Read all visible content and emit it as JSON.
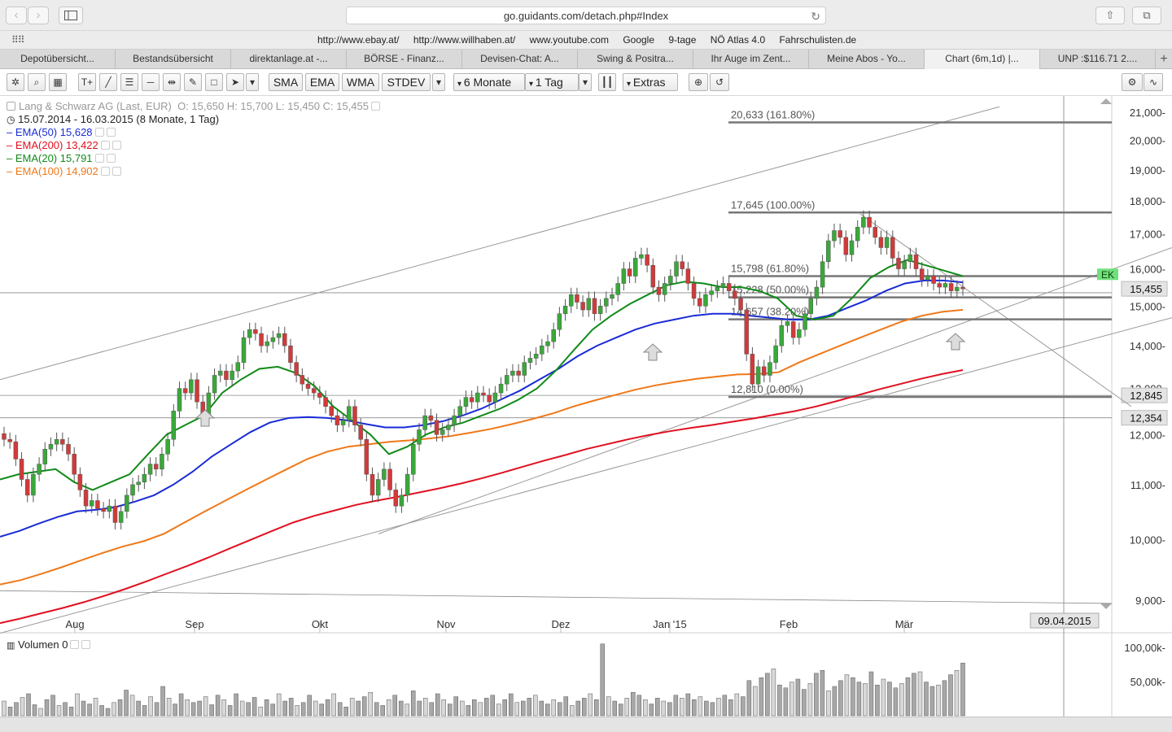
{
  "browser": {
    "url": "go.guidants.com/detach.php#Index",
    "favorites": [
      "http://www.ebay.at/",
      "http://www.willhaben.at/",
      "www.youtube.com",
      "Google",
      "9-tage",
      "NÖ Atlas 4.0",
      "Fahrschulisten.de"
    ],
    "tabs": [
      {
        "label": "Depotübersicht..."
      },
      {
        "label": "Bestandsübersicht"
      },
      {
        "label": "direktanlage.at -..."
      },
      {
        "label": "BÖRSE - Finanz..."
      },
      {
        "label": "Devisen-Chat: A..."
      },
      {
        "label": "Swing & Positra..."
      },
      {
        "label": "Ihr Auge im Zent..."
      },
      {
        "label": "Meine Abos - Yo..."
      },
      {
        "label": "Chart (6m,1d) |...",
        "active": true
      },
      {
        "label": "UNP :$116.71 2...."
      }
    ]
  },
  "toolbar": {
    "indicators": [
      "SMA",
      "EMA",
      "WMA",
      "STDEV"
    ],
    "period": "6 Monate",
    "interval": "1 Tag",
    "extras": "Extras"
  },
  "legend": {
    "instrument": "Lang & Schwarz AG (Last, EUR)",
    "ohlc": "O: 15,650  H: 15,700  L: 15,450  C: 15,455",
    "range": "15.07.2014 - 16.03.2015 (8 Monate, 1 Tag)",
    "emas": [
      {
        "name": "EMA(50)",
        "value": "15,628",
        "color": "#1a2bd6"
      },
      {
        "name": "EMA(200)",
        "value": "13,422",
        "color": "#e01020"
      },
      {
        "name": "EMA(20)",
        "value": "15,791",
        "color": "#108a18"
      },
      {
        "name": "EMA(100)",
        "value": "14,902",
        "color": "#f07818"
      }
    ]
  },
  "volume_label": "Volumen 0",
  "chart_data": {
    "type": "candlestick",
    "x_labels": [
      "Aug",
      "Sep",
      "Okt",
      "Nov",
      "Dez",
      "Jan '15",
      "Feb",
      "Mär"
    ],
    "y_ticks": [
      "21,000-",
      "20,000-",
      "19,000-",
      "18,000-",
      "17,000-",
      "16,000-",
      "15,000-",
      "14,000-",
      "13,000-",
      "12,000-",
      "11,000-",
      "10,000-",
      "9,000-"
    ],
    "y_log_scale": true,
    "volume_ticks": [
      "100,00k-",
      "50,00k-"
    ],
    "current_price_label": "15,455",
    "ek_label": "EK",
    "crosshair_date": "09.04.2015",
    "horizontal_level_labels": [
      {
        "value": 12.845,
        "label": "12,845"
      },
      {
        "value": 12.354,
        "label": "12,354"
      }
    ],
    "fibonacci": [
      {
        "value": 20.633,
        "label": "20,633 (161.80%)"
      },
      {
        "value": 17.645,
        "label": "17,645 (100.00%)"
      },
      {
        "value": 15.798,
        "label": "15,798 (61.80%)"
      },
      {
        "value": 15.228,
        "label": "15,228 (50.00%)"
      },
      {
        "value": 14.657,
        "label": "14,657 (38.20%)"
      },
      {
        "value": 12.81,
        "label": "12,810 (0.00%)"
      }
    ],
    "candles_close": [
      11.9,
      11.85,
      11.5,
      11.1,
      10.8,
      11.2,
      11.4,
      11.7,
      11.8,
      11.9,
      11.8,
      11.6,
      11.2,
      10.9,
      10.6,
      10.7,
      10.55,
      10.5,
      10.6,
      10.3,
      10.5,
      10.8,
      11.0,
      11.05,
      11.2,
      11.4,
      11.3,
      11.6,
      11.9,
      12.5,
      13.0,
      12.9,
      13.2,
      12.7,
      12.4,
      12.9,
      13.3,
      13.4,
      13.2,
      13.4,
      13.6,
      14.2,
      14.4,
      14.3,
      14.0,
      14.1,
      14.2,
      14.3,
      14.0,
      13.6,
      13.3,
      13.1,
      13.0,
      12.9,
      12.8,
      12.6,
      12.4,
      12.2,
      12.3,
      12.6,
      12.2,
      11.9,
      11.2,
      10.8,
      11.1,
      11.3,
      10.9,
      10.6,
      10.8,
      11.2,
      11.8,
      12.1,
      12.4,
      12.3,
      12.0,
      12.1,
      12.2,
      12.4,
      12.6,
      12.8,
      12.7,
      12.9,
      12.85,
      12.7,
      12.9,
      13.1,
      13.3,
      13.4,
      13.3,
      13.6,
      13.7,
      13.8,
      14.0,
      14.1,
      14.4,
      14.8,
      15.0,
      15.3,
      15.1,
      14.9,
      15.2,
      14.8,
      15.0,
      15.2,
      15.3,
      15.6,
      16.0,
      15.8,
      16.3,
      16.4,
      16.1,
      15.5,
      15.3,
      15.6,
      15.8,
      16.2,
      16.0,
      15.6,
      15.2,
      15.0,
      15.3,
      15.4,
      15.5,
      15.6,
      15.4,
      15.2,
      14.9,
      13.8,
      13.1,
      13.5,
      13.3,
      13.6,
      14.0,
      14.5,
      14.6,
      14.2,
      14.4,
      14.8,
      15.2,
      15.5,
      16.2,
      16.8,
      17.1,
      16.9,
      16.4,
      16.8,
      17.2,
      17.5,
      17.2,
      16.9,
      16.6,
      16.9,
      16.3,
      16.0,
      16.2,
      16.4,
      16.0,
      15.7,
      15.8,
      15.6,
      15.5,
      15.6,
      15.4,
      15.5,
      15.455
    ],
    "ema20": [
      11.1,
      11.2,
      11.25,
      11.3,
      11.05,
      10.9,
      11.05,
      11.2,
      11.6,
      12.0,
      12.2,
      12.4,
      12.9,
      13.2,
      13.45,
      13.5,
      13.35,
      13.05,
      12.6,
      12.3,
      12.0,
      11.6,
      11.75,
      12.0,
      12.15,
      12.25,
      12.4,
      12.55,
      12.75,
      13.0,
      13.4,
      13.9,
      14.4,
      14.75,
      15.05,
      15.3,
      15.55,
      15.65,
      15.6,
      15.5,
      15.5,
      15.4,
      15.2,
      14.75,
      14.65,
      14.75,
      15.2,
      15.75,
      16.05,
      16.25,
      16.1,
      15.95,
      15.8
    ],
    "ema50": [
      10.05,
      10.15,
      10.28,
      10.4,
      10.5,
      10.53,
      10.58,
      10.68,
      10.8,
      11.0,
      11.25,
      11.55,
      11.8,
      12.05,
      12.25,
      12.35,
      12.37,
      12.35,
      12.3,
      12.22,
      12.15,
      12.15,
      12.2,
      12.28,
      12.4,
      12.55,
      12.75,
      12.95,
      13.2,
      13.45,
      13.75,
      14.0,
      14.2,
      14.4,
      14.55,
      14.65,
      14.75,
      14.8,
      14.8,
      14.75,
      14.7,
      14.65,
      14.65,
      14.75,
      14.95,
      15.15,
      15.4,
      15.6,
      15.68,
      15.68,
      15.63
    ],
    "ema100": [
      9.25,
      9.32,
      9.42,
      9.53,
      9.65,
      9.77,
      9.88,
      9.97,
      10.1,
      10.3,
      10.5,
      10.7,
      10.9,
      11.1,
      11.3,
      11.5,
      11.65,
      11.75,
      11.8,
      11.85,
      11.88,
      11.92,
      11.97,
      12.04,
      12.12,
      12.22,
      12.33,
      12.45,
      12.6,
      12.73,
      12.85,
      12.97,
      13.07,
      13.15,
      13.22,
      13.27,
      13.32,
      13.33,
      13.37,
      13.6,
      13.8,
      14.0,
      14.2,
      14.4,
      14.6,
      14.75,
      14.85,
      14.902
    ],
    "ema200": [
      8.65,
      8.72,
      8.8,
      8.88,
      8.97,
      9.07,
      9.18,
      9.3,
      9.43,
      9.56,
      9.7,
      9.85,
      10.0,
      10.15,
      10.3,
      10.42,
      10.52,
      10.62,
      10.7,
      10.77,
      10.85,
      10.93,
      11.02,
      11.12,
      11.23,
      11.35,
      11.47,
      11.58,
      11.7,
      11.8,
      11.9,
      11.99,
      12.07,
      12.14,
      12.2,
      12.27,
      12.34,
      12.42,
      12.5,
      12.6,
      12.72,
      12.85,
      12.98,
      13.1,
      13.22,
      13.33,
      13.422
    ],
    "volumes": [
      20,
      12,
      18,
      25,
      30,
      15,
      10,
      22,
      28,
      14,
      18,
      12,
      30,
      20,
      16,
      24,
      14,
      10,
      18,
      22,
      35,
      28,
      20,
      14,
      26,
      18,
      40,
      24,
      16,
      30,
      22,
      18,
      20,
      26,
      15,
      28,
      22,
      14,
      30,
      20,
      18,
      25,
      12,
      22,
      16,
      30,
      20,
      24,
      14,
      18,
      28,
      20,
      16,
      22,
      30,
      18,
      12,
      24,
      20,
      26,
      32,
      18,
      14,
      22,
      28,
      20,
      16,
      34,
      20,
      24,
      18,
      30,
      22,
      16,
      26,
      20,
      14,
      22,
      18,
      24,
      28,
      16,
      22,
      30,
      18,
      20,
      24,
      28,
      20,
      16,
      22,
      18,
      26,
      14,
      20,
      24,
      30,
      22,
      98,
      26,
      20,
      16,
      24,
      32,
      28,
      22,
      16,
      24,
      20,
      18,
      28,
      24,
      30,
      22,
      26,
      20,
      18,
      24,
      28,
      22,
      30,
      26,
      48,
      40,
      52,
      58,
      64,
      42,
      38,
      46,
      50,
      36,
      44,
      58,
      62,
      34,
      40,
      48,
      56,
      52,
      46,
      44,
      60,
      42,
      50,
      46,
      38,
      44,
      52,
      58,
      60,
      46,
      40,
      42,
      48,
      56,
      62,
      72
    ]
  }
}
